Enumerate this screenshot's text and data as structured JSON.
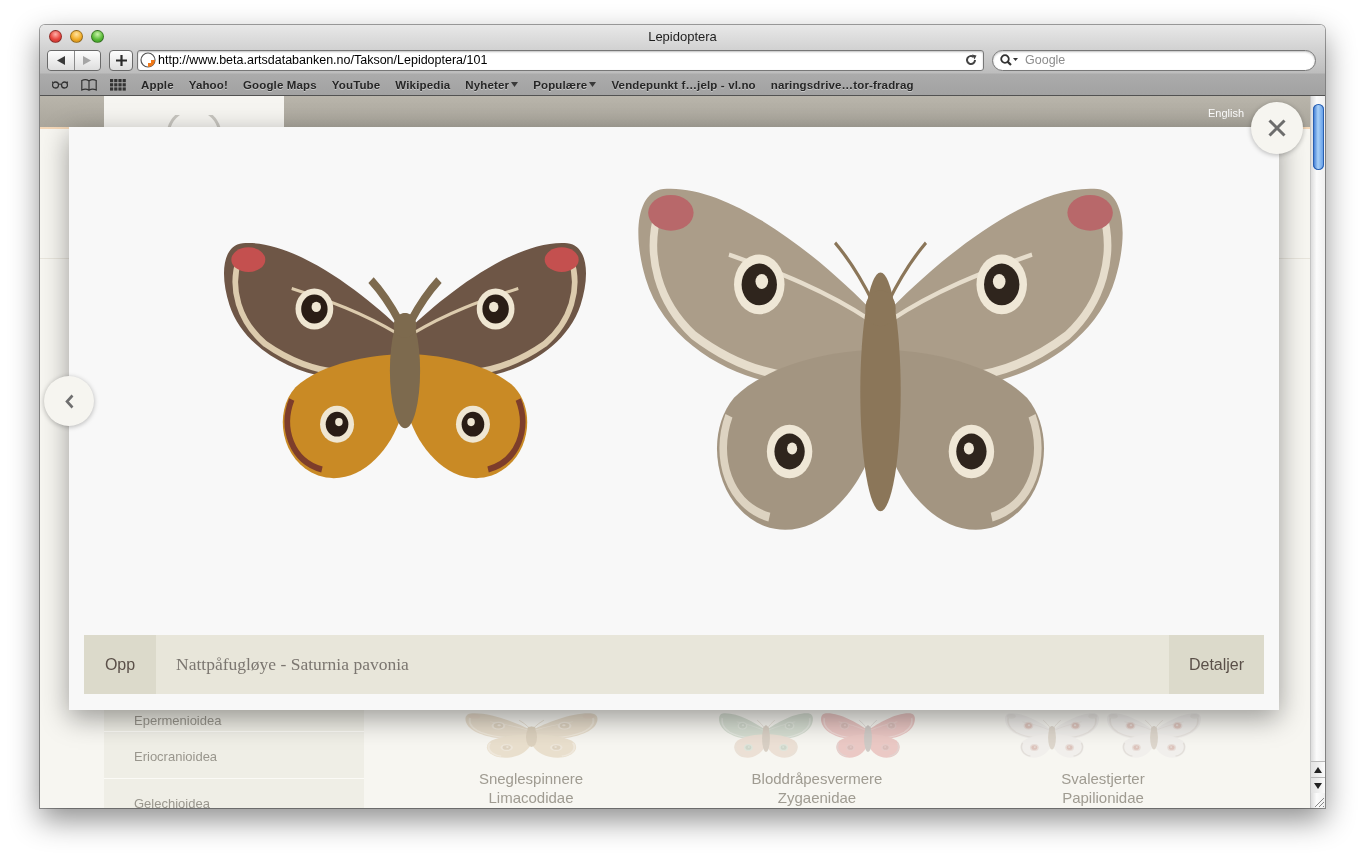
{
  "window": {
    "title": "Lepidoptera"
  },
  "toolbar": {
    "nav_buttons": [
      {
        "kind": "back",
        "disabled": false
      },
      {
        "kind": "forward",
        "disabled": true
      }
    ],
    "url": "http://www.beta.artsdatabanken.no/Takson/Lepidoptera/101",
    "search": {
      "placeholder": "Google"
    }
  },
  "bookmarks": [
    {
      "label": "Apple",
      "menu": false
    },
    {
      "label": "Yahoo!",
      "menu": false
    },
    {
      "label": "Google Maps",
      "menu": false
    },
    {
      "label": "YouTube",
      "menu": false
    },
    {
      "label": "Wikipedia",
      "menu": false
    },
    {
      "label": "Nyheter",
      "menu": true
    },
    {
      "label": "Populære",
      "menu": true
    },
    {
      "label": "Vendepunkt f…jelp - vl.no",
      "menu": false
    },
    {
      "label": "naringsdrive…tor-fradrag",
      "menu": false
    }
  ],
  "page": {
    "language_link": "English",
    "sidebar": {
      "items": [
        "Epermenioidea",
        "Eriocranioidea",
        "Gelechioidea"
      ]
    },
    "cards": [
      {
        "name": "Sneglespinnere",
        "family": "Limacodidae"
      },
      {
        "name": "Bloddråpesvermere",
        "family": "Zygaenidae"
      },
      {
        "name": "Svalestjerter",
        "family": "Papilionidae"
      }
    ]
  },
  "lightbox": {
    "specimens": [
      {
        "kind": "small"
      },
      {
        "kind": "large"
      }
    ],
    "up_button": "Opp",
    "caption": "Nattpåfugløye - Saturnia pavonia",
    "details_button": "Detaljer"
  }
}
